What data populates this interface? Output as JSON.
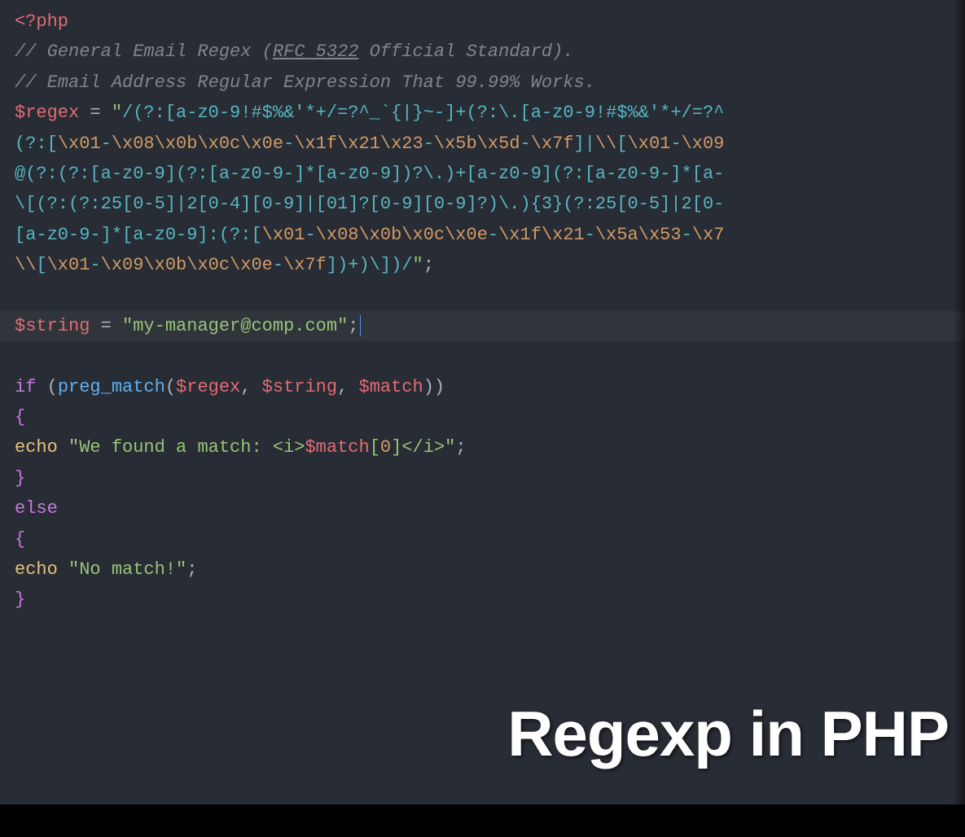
{
  "lines": {
    "l1_open": "<?php",
    "l2_comment_pre": "// General Email Regex (",
    "l2_comment_link": "RFC 5322",
    "l2_comment_post": " Official Standard).",
    "l3_comment": "// Email Address Regular Expression That 99.99% Works.",
    "l4_var": "$regex",
    "l4_eq": " = ",
    "l4_q": "\"",
    "l4_regex": "/(?:[a-z0-9!#$%&'*+/=?^_`{|}~-]+(?:\\.[a-z0-9!#$%&'*+/=?^",
    "l5_a": "(?:[",
    "l5_e1": "\\x01",
    "l5_b": "-",
    "l5_e2": "\\x08\\x0b\\x0c\\x0e",
    "l5_c": "-",
    "l5_e3": "\\x1f\\x21\\x23",
    "l5_d": "-",
    "l5_e4": "\\x5b\\x5d",
    "l5_f": "-",
    "l5_e5": "\\x7f",
    "l5_g": "]|",
    "l5_e6": "\\\\",
    "l5_h": "[",
    "l5_e7": "\\x01",
    "l5_i": "-",
    "l5_e8": "\\x09",
    "l6_regex": "@(?:(?:[a-z0-9](?:[a-z0-9-]*[a-z0-9])?\\.)+[a-z0-9](?:[a-z0-9-]*[a-",
    "l7_regex": "\\[(?:(?:25[0-5]|2[0-4][0-9]|[01]?[0-9][0-9]?)\\.){3}(?:25[0-5]|2[0-",
    "l8_a": "[a-z0-9-]*[a-z0-9]:(?:[",
    "l8_e1": "\\x01",
    "l8_b": "-",
    "l8_e2": "\\x08\\x0b\\x0c\\x0e",
    "l8_c": "-",
    "l8_e3": "\\x1f\\x21",
    "l8_d": "-",
    "l8_e4": "\\x5a\\x53",
    "l8_f": "-",
    "l8_e5": "\\x7",
    "l9_e1": "\\\\",
    "l9_a": "[",
    "l9_e2": "\\x01",
    "l9_b": "-",
    "l9_e3": "\\x09\\x0b\\x0c\\x0e",
    "l9_c": "-",
    "l9_e4": "\\x7f",
    "l9_d": "])+)\\])/",
    "l9_q": "\"",
    "l9_semi": ";",
    "l11_var": "$string",
    "l11_eq": " = ",
    "l11_val": "\"my-manager@comp.com\"",
    "l11_semi": ";",
    "l13_if": "if",
    "l13_open": " (",
    "l13_func": "preg_match",
    "l13_open2": "(",
    "l13_a1": "$regex",
    "l13_c1": ", ",
    "l13_a2": "$string",
    "l13_c2": ", ",
    "l13_a3": "$match",
    "l13_close": "))",
    "l14_brace": "{",
    "l15_indent": "  ",
    "l15_echo": "echo",
    "l15_sp": " ",
    "l15_str1": "\"We found a match: <i>",
    "l15_var": "$match",
    "l15_idx_open": "[",
    "l15_idx": "0",
    "l15_idx_close": "]",
    "l15_str2": "</i>\"",
    "l15_semi": ";",
    "l16_brace": "}",
    "l17_else": "else",
    "l18_brace": "{",
    "l19_indent": "  ",
    "l19_echo": "echo",
    "l19_sp": " ",
    "l19_str": "\"No match!\"",
    "l19_semi": ";",
    "l20_brace": "}"
  },
  "overlay": {
    "title": "Regexp in PHP"
  }
}
